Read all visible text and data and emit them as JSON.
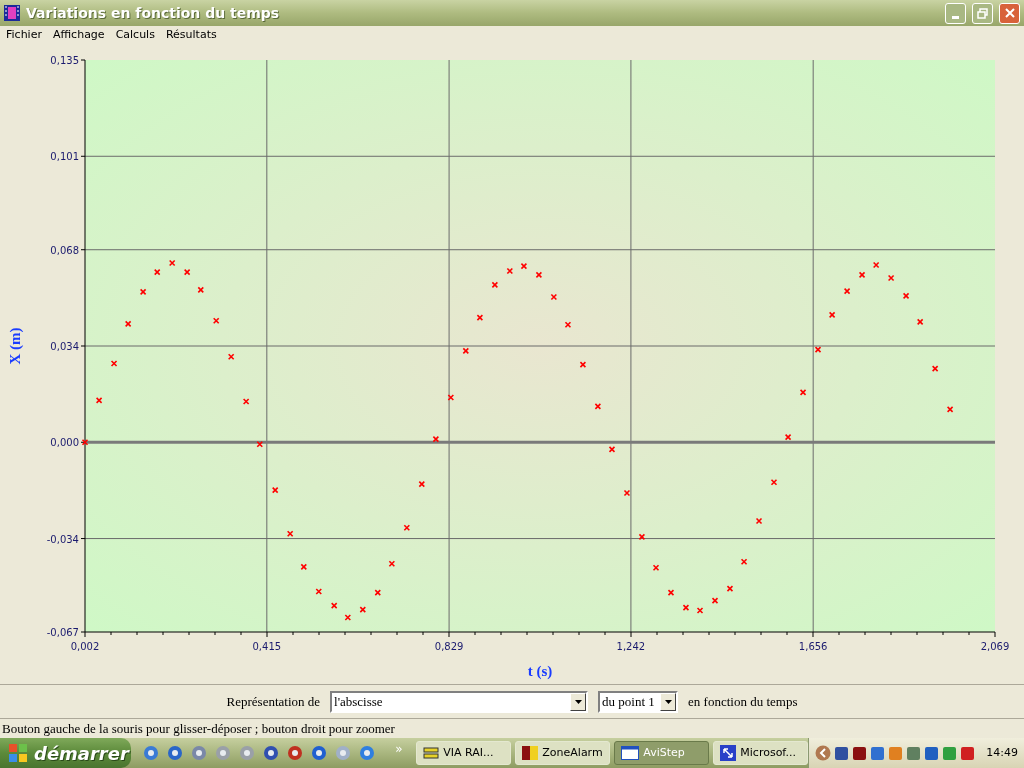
{
  "window": {
    "title": "Variations en fonction du temps"
  },
  "menu": [
    "Fichier",
    "Affichage",
    "Calculs",
    "Résultats"
  ],
  "chart_data": {
    "type": "scatter",
    "grid": true,
    "xlabel": "t (s)",
    "ylabel": "X (m)",
    "xlim": [
      0.002,
      2.069
    ],
    "ylim": [
      -0.067,
      0.135
    ],
    "xticks": [
      {
        "value": 0.002,
        "label": "0,002"
      },
      {
        "value": 0.415,
        "label": "0,415"
      },
      {
        "value": 0.829,
        "label": "0,829"
      },
      {
        "value": 1.242,
        "label": "1,242"
      },
      {
        "value": 1.656,
        "label": "1,656"
      },
      {
        "value": 2.069,
        "label": "2,069"
      }
    ],
    "yticks": [
      {
        "value": -0.067,
        "label": "-0,067"
      },
      {
        "value": -0.034,
        "label": "-0,034"
      },
      {
        "value": 0,
        "label": "0,000"
      },
      {
        "value": 0.034,
        "label": "0,034"
      },
      {
        "value": 0.068,
        "label": "0,068"
      },
      {
        "value": 0.101,
        "label": "0,101"
      },
      {
        "value": 0.135,
        "label": "0,135"
      }
    ],
    "x": [
      0.002,
      0.034,
      0.068,
      0.1,
      0.134,
      0.166,
      0.2,
      0.234,
      0.265,
      0.3,
      0.334,
      0.368,
      0.399,
      0.434,
      0.468,
      0.499,
      0.533,
      0.568,
      0.599,
      0.633,
      0.667,
      0.699,
      0.733,
      0.767,
      0.799,
      0.833,
      0.867,
      0.899,
      0.933,
      0.967,
      0.999,
      1.033,
      1.067,
      1.099,
      1.133,
      1.167,
      1.199,
      1.233,
      1.267,
      1.299,
      1.333,
      1.367,
      1.399,
      1.433,
      1.467,
      1.499,
      1.533,
      1.567,
      1.599,
      1.633,
      1.667,
      1.699,
      1.733,
      1.767,
      1.799,
      1.833,
      1.867,
      1.899,
      1.933,
      1.967
    ],
    "series": [
      {
        "color": "#ff0000",
        "values": [
          0.0,
          0.0148,
          0.0278,
          0.0418,
          0.0531,
          0.0601,
          0.0633,
          0.0601,
          0.0538,
          0.0429,
          0.0302,
          0.0144,
          -0.0007,
          -0.0169,
          -0.0323,
          -0.044,
          -0.0527,
          -0.0577,
          -0.0619,
          -0.0591,
          -0.0531,
          -0.0429,
          -0.0302,
          -0.0148,
          0.0011,
          0.0158,
          0.0323,
          0.044,
          0.0556,
          0.0605,
          0.0622,
          0.0591,
          0.0513,
          0.0415,
          0.0274,
          0.0127,
          -0.0025,
          -0.0179,
          -0.0334,
          -0.0443,
          -0.0531,
          -0.0584,
          -0.0594,
          -0.0559,
          -0.0517,
          -0.0422,
          -0.0278,
          -0.0141,
          0.0018,
          0.0176,
          0.0327,
          0.045,
          0.0534,
          0.0591,
          0.0626,
          0.058,
          0.0517,
          0.0425,
          0.026,
          0.0116
        ]
      }
    ]
  },
  "controls": {
    "label": "Représentation de",
    "quantity": "l'abscisse",
    "point": "du point 1",
    "suffix": "en fonction du temps"
  },
  "status_bar": "Bouton gauche de la souris pour glisser-déposer ; bouton droit pour zoomer",
  "taskbar": {
    "start": "démarrer",
    "more": "»",
    "tasks": [
      {
        "label": "VIA RAI...",
        "selected": false
      },
      {
        "label": "ZoneAlarm",
        "selected": false
      },
      {
        "label": "AviStep",
        "selected": true
      },
      {
        "label": "Microsof...",
        "selected": false
      }
    ],
    "clock": "14:49"
  }
}
